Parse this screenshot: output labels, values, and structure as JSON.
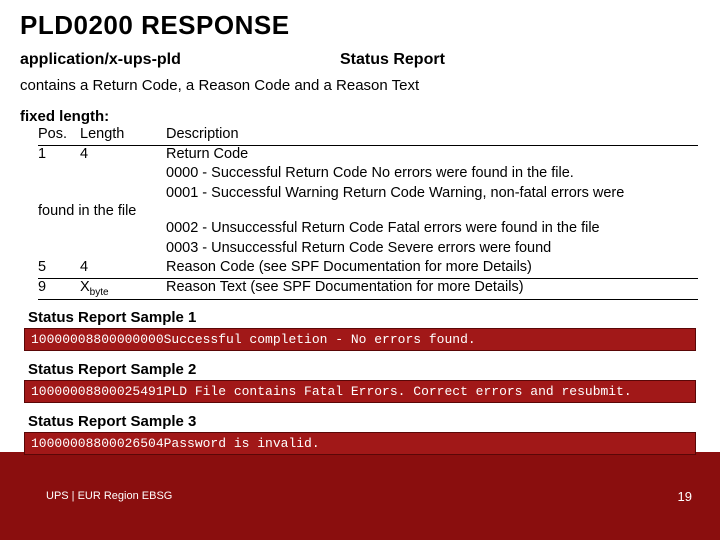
{
  "title": "PLD0200 RESPONSE",
  "meta": {
    "mime": "application/x-ups-pld",
    "right": "Status Report"
  },
  "subtitle": "contains a  Return Code, a Reason Code and a Reason Text",
  "fixed_label": "fixed length:",
  "headers": {
    "pos": "Pos.",
    "len": "Length",
    "desc": "Description"
  },
  "rows": [
    {
      "pos": "1",
      "len": "4",
      "desc": "Return Code"
    }
  ],
  "return_codes": [
    "0000 - Successful Return Code No errors were found in the file.",
    "0001 - Successful Warning Return Code Warning, non-fatal errors were"
  ],
  "found_line": "found in the file",
  "return_codes_2": [
    "0002 - Unsuccessful Return Code Fatal errors were found in the file",
    "0003 - Unsuccessful Return Code Severe errors were found"
  ],
  "rows2": [
    {
      "pos": "5",
      "len": "4",
      "desc": "Reason Code (see SPF Documentation for more Details)"
    },
    {
      "pos": "9",
      "len_pre": "X",
      "len_sub": "byte",
      "desc": "Reason Text (see SPF Documentation for more Details)"
    }
  ],
  "samples": [
    {
      "h": "Status Report Sample 1",
      "body": "10000008800000000Successful completion - No errors found."
    },
    {
      "h": "Status Report Sample 2",
      "body": "10000008800025491PLD File contains Fatal Errors. Correct errors and resubmit."
    },
    {
      "h": "Status Report Sample 3",
      "body": "10000008800026504Password is invalid."
    }
  ],
  "footer": {
    "left": "UPS | EUR Region EBSG",
    "page": "19"
  }
}
